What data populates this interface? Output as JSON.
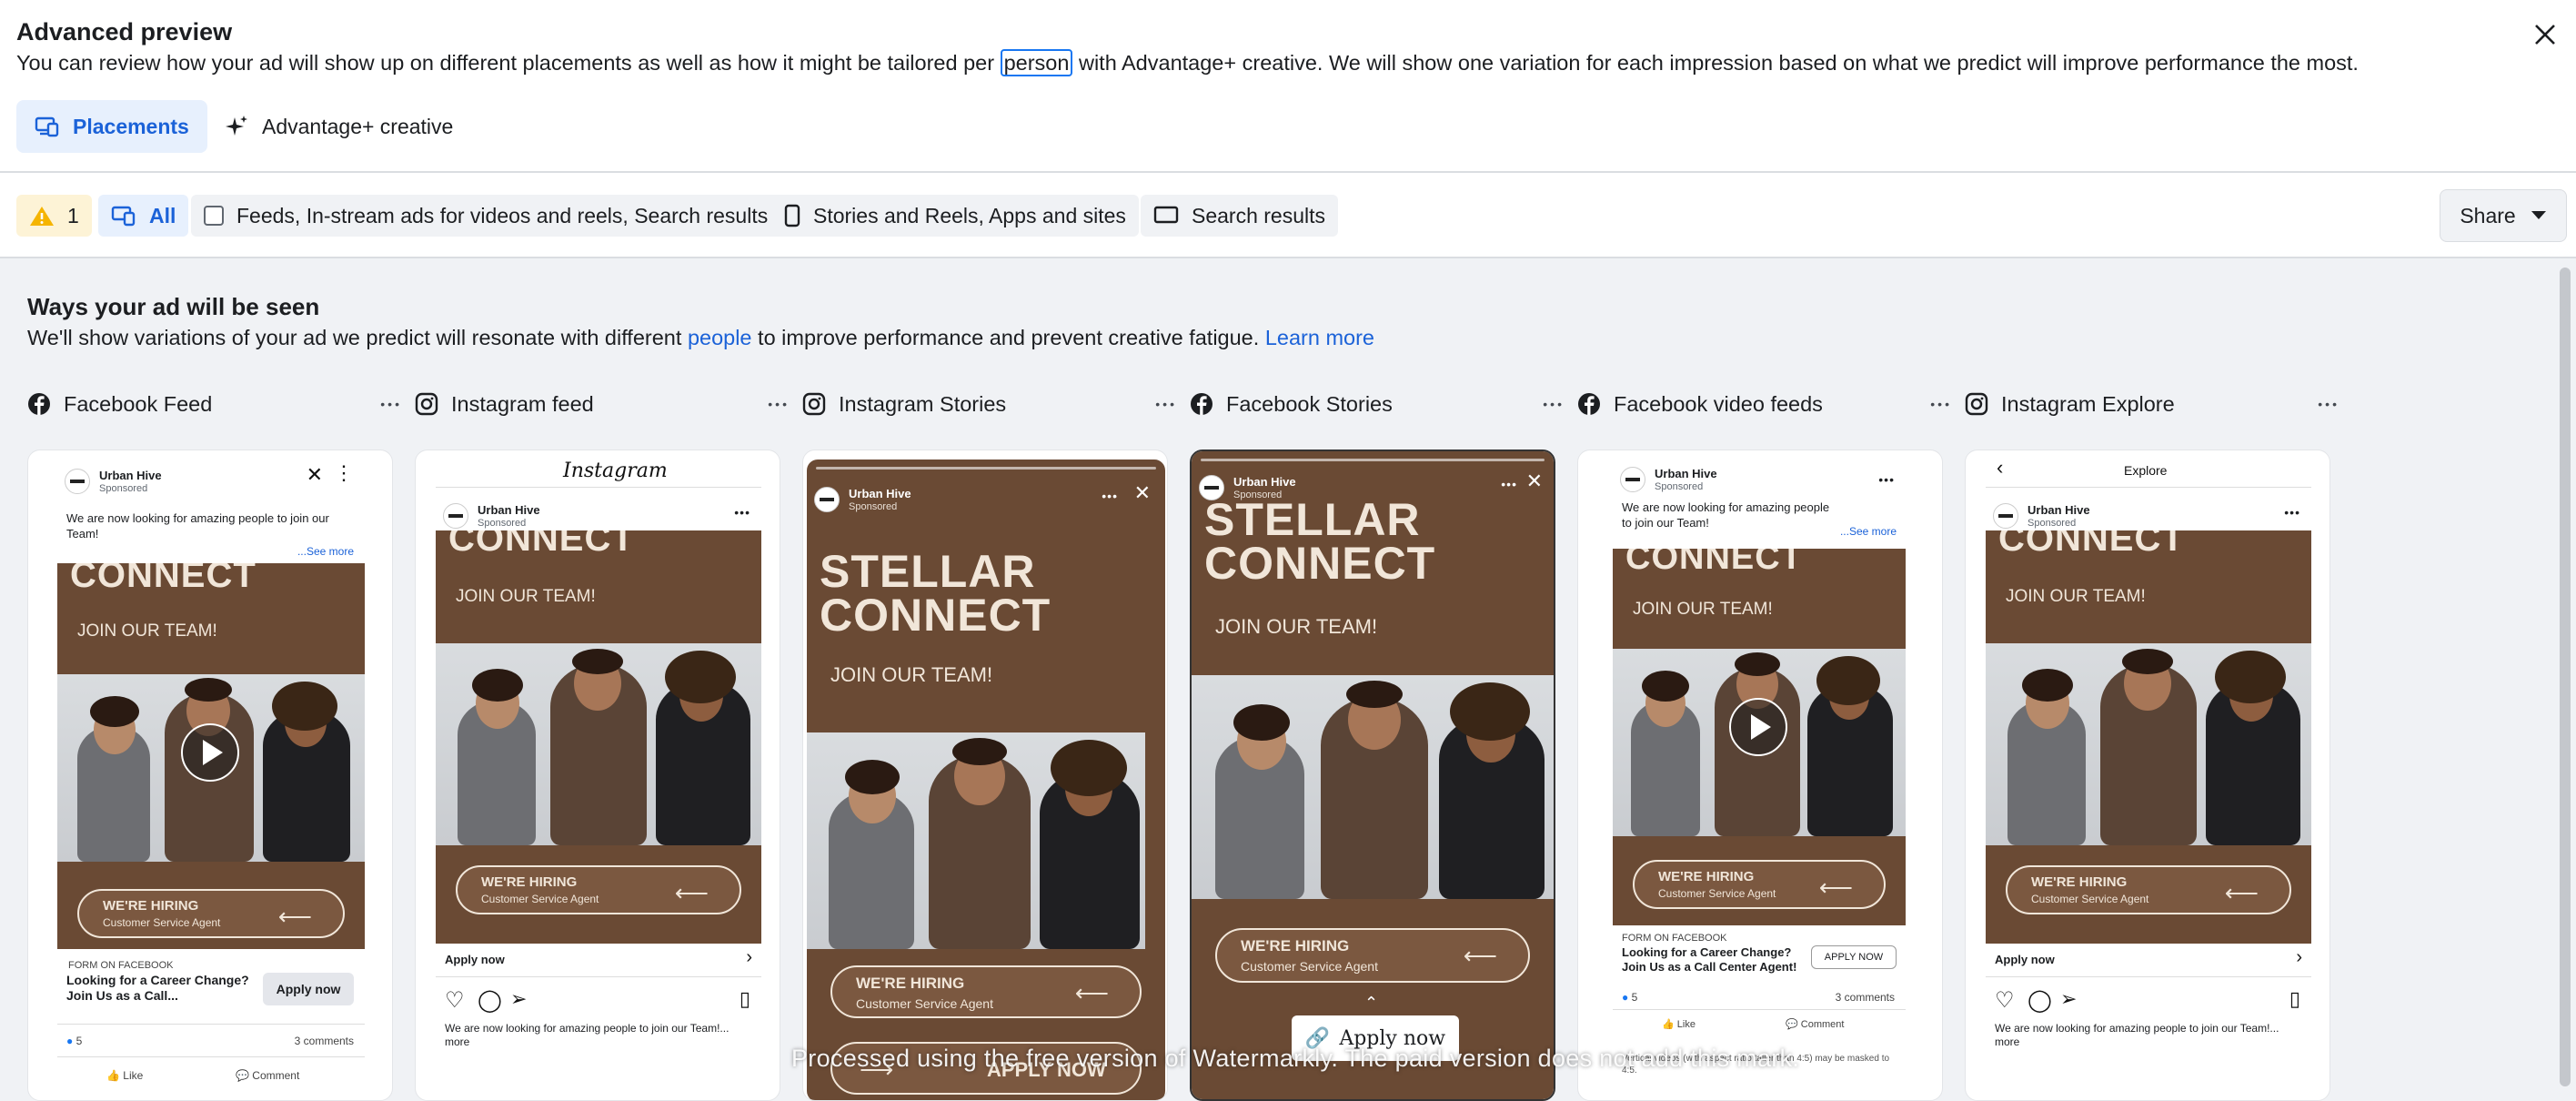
{
  "header": {
    "title": "Advanced preview",
    "description_before": "You can review how your ad will show up on different placements as well as how it might be tailored per ",
    "description_highlight": "person",
    "description_after": " with Advantage+ creative. We will show one variation for each impression based on what we predict will improve performance the most.",
    "tabs": [
      {
        "label": "Placements",
        "icon": "placements-icon",
        "active": true
      },
      {
        "label": "Advantage+ creative",
        "icon": "sparkle-icon",
        "active": false
      }
    ]
  },
  "filters": {
    "warning_count": "1",
    "all_label": "All",
    "options": [
      {
        "label": "Feeds, In-stream ads for videos and reels, Search results"
      },
      {
        "label": "Stories and Reels, Apps and sites"
      },
      {
        "label": "Search results"
      }
    ],
    "share_label": "Share"
  },
  "section": {
    "title": "Ways your ad will be seen",
    "desc_before": "We'll show variations of your ad we predict will resonate with different ",
    "desc_link": "people",
    "desc_after": " to improve performance and prevent creative fatigue. ",
    "learn_more": "Learn more"
  },
  "placements": [
    {
      "label": "Facebook Feed",
      "icon": "facebook-icon"
    },
    {
      "label": "Instagram feed",
      "icon": "instagram-icon"
    },
    {
      "label": "Instagram Stories",
      "icon": "instagram-icon"
    },
    {
      "label": "Facebook Stories",
      "icon": "facebook-icon"
    },
    {
      "label": "Facebook video feeds",
      "icon": "facebook-icon"
    },
    {
      "label": "Instagram Explore",
      "icon": "instagram-icon"
    }
  ],
  "ad": {
    "page_name": "Urban Hive",
    "sponsored": "Sponsored",
    "primary_text": "We are now looking for amazing people to join our Team!",
    "see_more": "...See more",
    "headline_line1": "STELLAR",
    "headline_line2": "CONNECT",
    "join": "JOIN OUR TEAM!",
    "hiring": "WE'RE HIRING",
    "role": "Customer Service Agent",
    "form_label": "FORM ON FACEBOOK",
    "lead_title": "Looking for a Career Change? Join Us as a Call Center Agent!",
    "lead_title_short": "Looking for a Career Change? Join Us as a Call...",
    "cta": "Apply now",
    "cta_upper": "APPLY NOW",
    "reactions": "5",
    "comments": "3 comments",
    "like": "Like",
    "comment": "Comment",
    "ig_brand": "Instagram",
    "ig_caption": "We are now looking for amazing people to join our Team!... more",
    "explore": "Explore",
    "disclaimer": "Vertical videos (with aspect ratio taller than 4:5) may be masked to 4:5."
  },
  "watermark": {
    "text": "Processed using the free version of Watermarkly. The paid version does not add this mark."
  }
}
